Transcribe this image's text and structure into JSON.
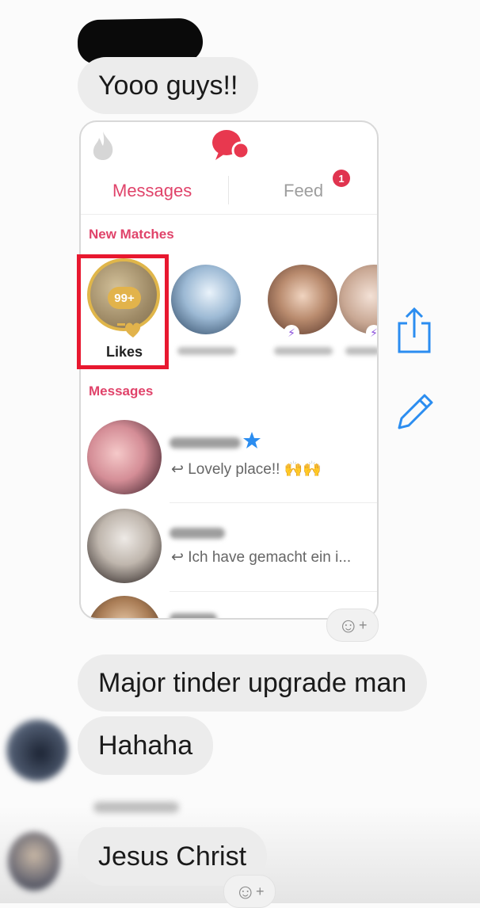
{
  "messages": [
    {
      "text": "Yooo guys!!"
    },
    {
      "text": "Major tinder upgrade man"
    },
    {
      "text": "Hahaha"
    },
    {
      "text": "Jesus Christ"
    }
  ],
  "shared_screenshot": {
    "tabs": {
      "messages": "Messages",
      "feed": "Feed",
      "feed_badge": "1"
    },
    "new_matches_label": "New Matches",
    "likes": {
      "count": "99+",
      "label": "Likes"
    },
    "messages_label": "Messages",
    "conversations": [
      {
        "preview": "Lovely place!! 🙌🙌",
        "starred": true
      },
      {
        "preview": "Ich have gemacht ein i...",
        "starred": false
      }
    ],
    "colors": {
      "accent": "#e0436a",
      "highlight": "#e8182f",
      "likes_gold": "#e2b34b",
      "ios_blue": "#2b8df0"
    }
  },
  "actions": {
    "share_icon": "share-icon",
    "edit_icon": "pencil-icon",
    "react_icon": "emoji-react-icon"
  }
}
